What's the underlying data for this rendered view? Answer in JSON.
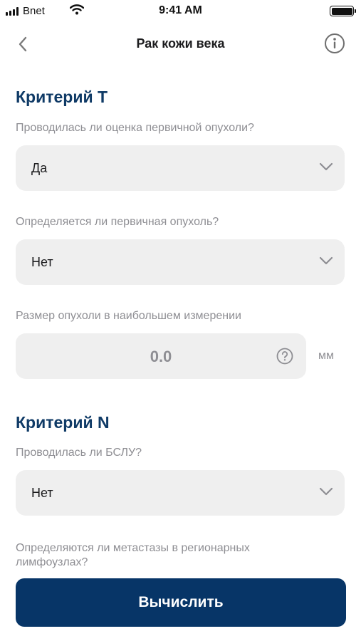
{
  "status_bar": {
    "carrier": "Bnet",
    "time": "9:41 AM",
    "icons": [
      "signal-icon",
      "wifi-icon",
      "battery-icon"
    ]
  },
  "nav": {
    "title": "Рак кожи века",
    "back_icon": "chevron-left-icon",
    "info_icon": "info-icon"
  },
  "criterion_t": {
    "title": "Критерий T",
    "q1": {
      "label": "Проводилась ли оценка первичной опухоли?",
      "value": "Да"
    },
    "q2": {
      "label": "Определяется ли первичная опухоль?",
      "value": "Нет"
    },
    "q3": {
      "label": "Размер опухоли в наибольшем измерении",
      "value": "0.0",
      "unit": "мм"
    }
  },
  "criterion_n": {
    "title": "Критерий N",
    "q1": {
      "label": "Проводилась ли БСЛУ?",
      "value": "Нет"
    },
    "q2": {
      "label": "Определяются ли метастазы в регионарных лимфоузлах?"
    }
  },
  "calculate_button": {
    "label": "Вычислить"
  },
  "colors": {
    "accent": "#0f3a66",
    "button": "#073567",
    "field_bg": "#efefef",
    "muted_text": "#8e8e93"
  }
}
